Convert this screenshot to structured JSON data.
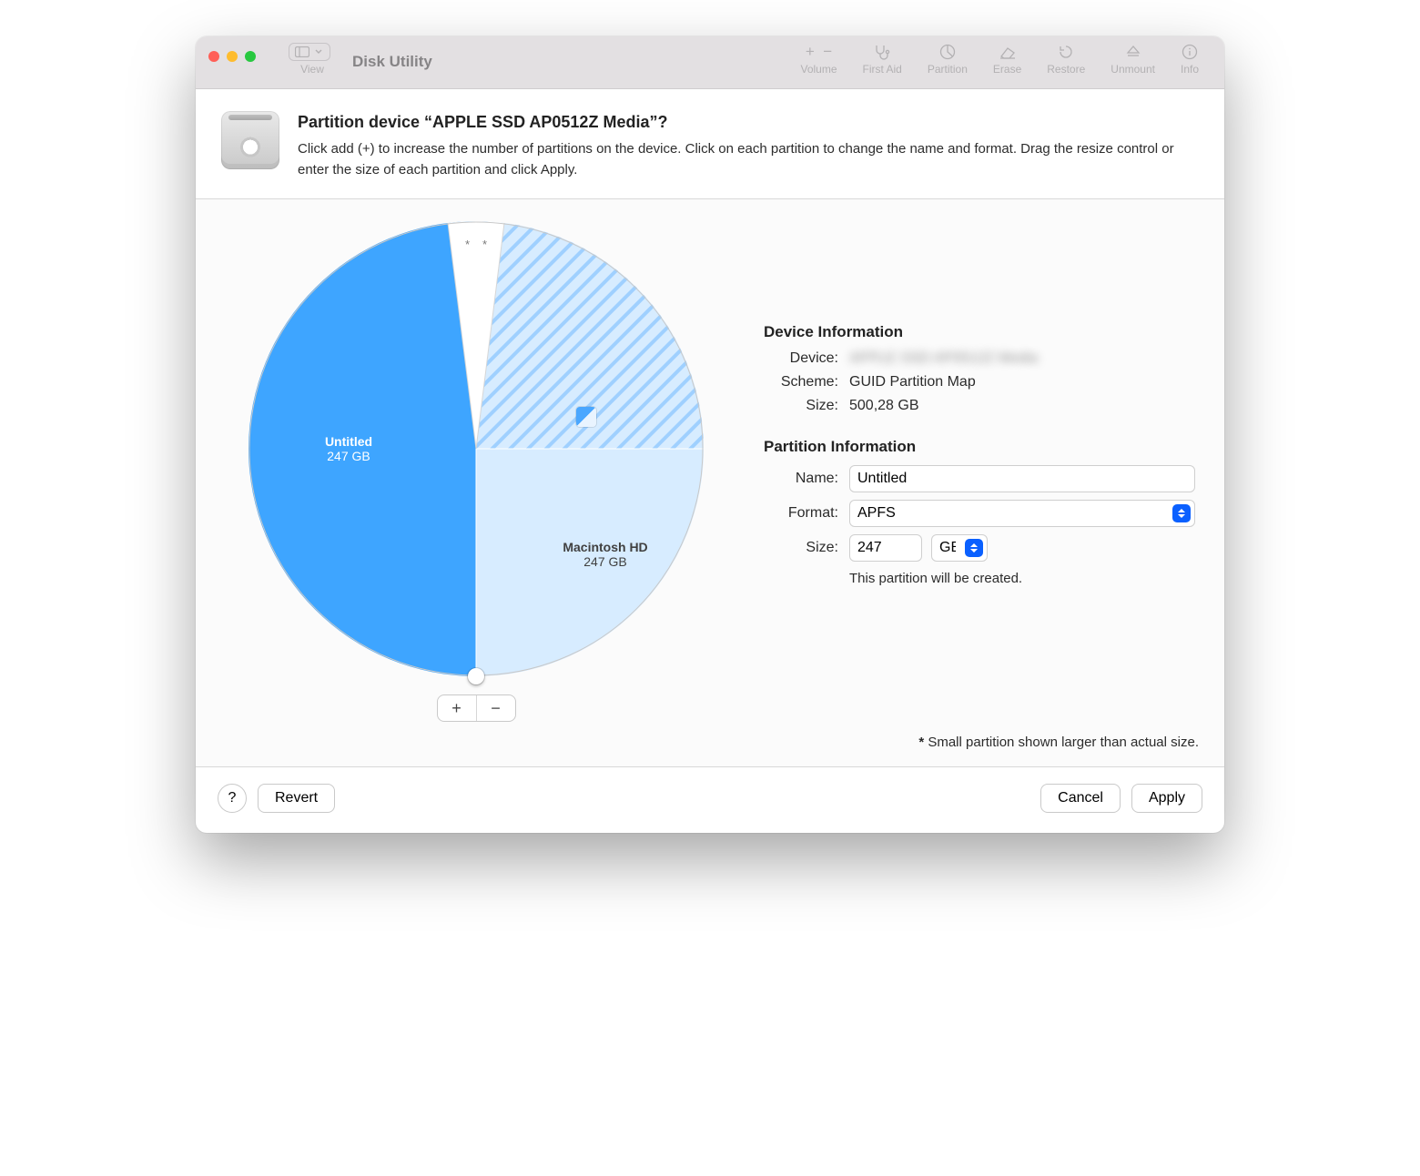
{
  "app_title": "Disk Utility",
  "toolbar": {
    "view_label": "View",
    "volume_label": "Volume",
    "first_aid_label": "First Aid",
    "partition_label": "Partition",
    "erase_label": "Erase",
    "restore_label": "Restore",
    "unmount_label": "Unmount",
    "info_label": "Info"
  },
  "sheet": {
    "title": "Partition device “APPLE SSD AP0512Z Media”?",
    "subtitle": "Click add (+) to increase the number of partitions on the device. Click on each partition to change the name and format. Drag the resize control or enter the size of each partition and click Apply."
  },
  "pie": {
    "left_name": "Untitled",
    "left_size": "247 GB",
    "right_name": "Macintosh HD",
    "right_size": "247 GB"
  },
  "device_info": {
    "heading": "Device Information",
    "device_label": "Device:",
    "device_value": "APPLE SSD AP0512Z Media",
    "scheme_label": "Scheme:",
    "scheme_value": "GUID Partition Map",
    "size_label": "Size:",
    "size_value": "500,28 GB"
  },
  "partition_info": {
    "heading": "Partition Information",
    "name_label": "Name:",
    "name_value": "Untitled",
    "format_label": "Format:",
    "format_value": "APFS",
    "size_label": "Size:",
    "size_value": "247",
    "size_unit": "GB",
    "hint": "This partition will be created."
  },
  "footnote": "Small partition shown larger than actual size.",
  "buttons": {
    "help": "?",
    "revert": "Revert",
    "cancel": "Cancel",
    "apply": "Apply",
    "plus": "+",
    "minus": "−"
  },
  "chart_data": {
    "type": "pie",
    "title": "",
    "total_gb": 500.28,
    "slices": [
      {
        "name": "Untitled",
        "value_gb": 247,
        "selected": true,
        "fill": "solid-blue"
      },
      {
        "name": "(small partition)",
        "value_gb": 3,
        "selected": false,
        "fill": "white",
        "note": "shown larger than actual size"
      },
      {
        "name": "(small partition)",
        "value_gb": 3,
        "selected": false,
        "fill": "white",
        "note": "shown larger than actual size"
      },
      {
        "name": "Macintosh HD",
        "value_gb": 247,
        "selected": false,
        "fill": "hatched-light-blue"
      }
    ],
    "displayed_angles_deg": [
      -180,
      -7,
      0,
      7
    ],
    "legend": []
  }
}
